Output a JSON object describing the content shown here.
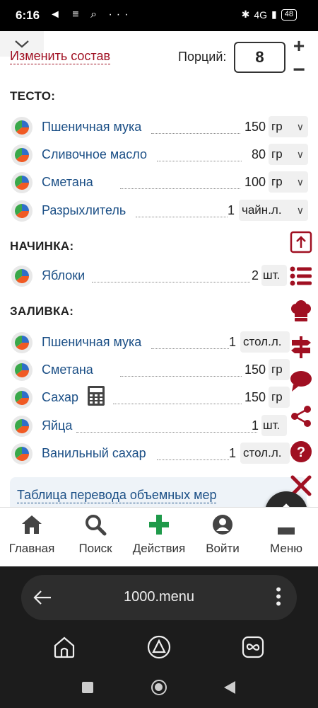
{
  "status_bar": {
    "time": "6:16",
    "left_icons": [
      "telegram-icon",
      "notes-icon",
      "search-icon",
      "more-icon"
    ],
    "left_icons_text": "◄ ≡ ⌕ ···",
    "network": "4G",
    "battery": "48"
  },
  "recipe": {
    "change_link": "Изменить состав",
    "portions_label": "Порций:",
    "portions_value": "8",
    "plus": "+",
    "minus": "−"
  },
  "sections": [
    {
      "title": "ТЕСТО:",
      "items": [
        {
          "name": "Пшеничная мука",
          "qty": "150",
          "unit": "гр"
        },
        {
          "name": "Сливочное масло",
          "qty": "80",
          "unit": "гр"
        },
        {
          "name": "Сметана",
          "qty": "100",
          "unit": "гр"
        },
        {
          "name": "Разрыхлитель",
          "qty": "1",
          "unit": "чайн.л."
        }
      ]
    },
    {
      "title": "НАЧИНКА:",
      "items": [
        {
          "name": "Яблоки",
          "qty": "2",
          "unit": "шт."
        }
      ]
    },
    {
      "title": "ЗАЛИВКА:",
      "items": [
        {
          "name": "Пшеничная мука",
          "qty": "1",
          "unit": "стол.л."
        },
        {
          "name": "Сметана",
          "qty": "150",
          "unit": "гр"
        },
        {
          "name": "Сахар",
          "qty": "150",
          "unit": "гр"
        },
        {
          "name": "Яйца",
          "qty": "1",
          "unit": "шт."
        },
        {
          "name": "Ванильный сахар",
          "qty": "1",
          "unit": "стол.л."
        }
      ]
    }
  ],
  "table_link": "Таблица перевода объемных мер",
  "side_icons": [
    "scroll-to-top-icon",
    "list-icon",
    "chef-hat-icon",
    "signpost-icon",
    "comment-icon",
    "share-icon",
    "help-icon",
    "close-icon"
  ],
  "bottom_nav": [
    {
      "label": "Главная",
      "icon": "home-icon"
    },
    {
      "label": "Поиск",
      "icon": "search-icon"
    },
    {
      "label": "Действия",
      "icon": "plus-icon"
    },
    {
      "label": "Войти",
      "icon": "user-icon"
    },
    {
      "label": "Меню",
      "icon": "menu-icon"
    }
  ],
  "browser": {
    "url": "1000.menu"
  },
  "colors": {
    "accent_red": "#a01022",
    "link_blue": "#1b4f86",
    "action_green": "#1f9a4a"
  }
}
